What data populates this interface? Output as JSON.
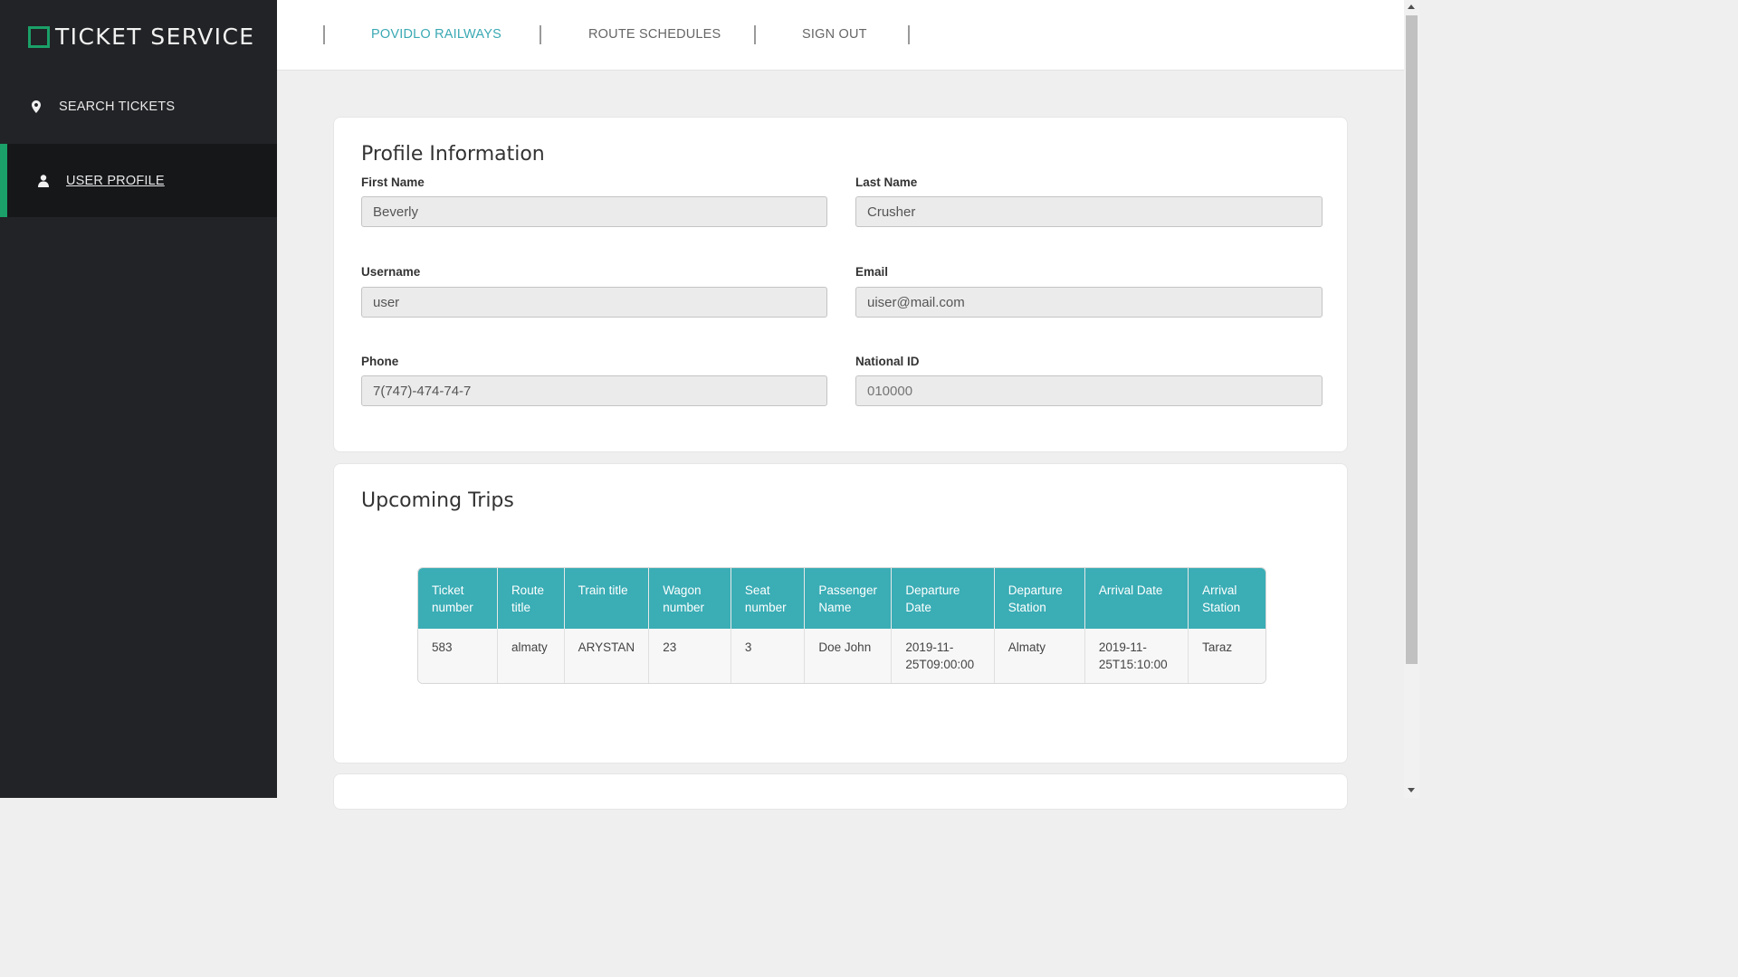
{
  "app": {
    "title": "TICKET SERVICE",
    "brand_color": "#1aa068"
  },
  "sidebar": {
    "items": [
      {
        "label": "SEARCH TICKETS",
        "icon": "map-marker-icon"
      },
      {
        "label": "USER PROFILE",
        "icon": "user-icon",
        "active": true
      }
    ]
  },
  "topnav": {
    "links": [
      {
        "label": "POVIDLO RAILWAYS",
        "active": true
      },
      {
        "label": "ROUTE SCHEDULES"
      },
      {
        "label": "SIGN OUT"
      }
    ]
  },
  "profile": {
    "title": "Profile Information",
    "first_name": {
      "label": "First Name",
      "value": "Beverly"
    },
    "last_name": {
      "label": "Last Name",
      "value": "Crusher"
    },
    "username": {
      "label": "Username",
      "value": "user"
    },
    "email": {
      "label": "Email",
      "value": "uiser@mail.com"
    },
    "phone": {
      "label": "Phone",
      "value": "7(747)-474-74-7"
    },
    "national_id": {
      "label": "National ID",
      "placeholder": "010000"
    }
  },
  "trips": {
    "title": "Upcoming Trips",
    "columns": [
      "Ticket number",
      "Route title",
      "Train title",
      "Wagon number",
      "Seat number",
      "Passenger Name",
      "Departure Date",
      "Departure Station",
      "Arrival Date",
      "Arrival Station"
    ],
    "rows": [
      [
        "583",
        "almaty",
        "ARYSTAN",
        "23",
        "3",
        "Doe John",
        "2019-11-25T09:00:00",
        "Almaty",
        "2019-11-25T15:10:00",
        "Taraz"
      ]
    ],
    "header_color": "#3aadb5"
  }
}
